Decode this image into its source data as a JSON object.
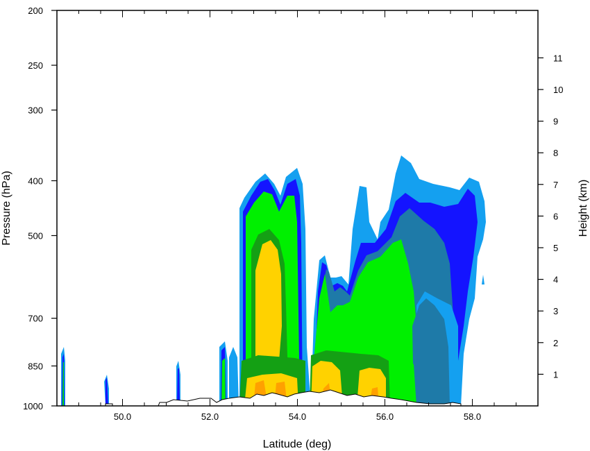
{
  "chart_data": {
    "type": "heatmap",
    "xlabel": "Latitude (deg)",
    "ylabel": "Pressure (hPa)",
    "y2label": "Height (km)",
    "xlim": [
      48.5,
      59.5
    ],
    "x_ticks": [
      50.0,
      52.0,
      54.0,
      56.0,
      58.0
    ],
    "x_tick_labels": [
      "50.0",
      "52.0",
      "54.0",
      "56.0",
      "58.0"
    ],
    "ylim": [
      1000,
      200
    ],
    "y_scale": "log",
    "y_ticks": [
      200,
      250,
      300,
      400,
      500,
      700,
      850,
      1000
    ],
    "y_tick_labels": [
      "200",
      "250",
      "300",
      "400",
      "500",
      "700",
      "850",
      "1000"
    ],
    "y2_ticks": [
      1,
      2,
      3,
      4,
      5,
      6,
      7,
      8,
      9,
      10,
      11
    ],
    "y2_tick_labels": [
      "1",
      "2",
      "3",
      "4",
      "5",
      "6",
      "7",
      "8",
      "9",
      "10",
      "11"
    ],
    "grid": false,
    "legend": "none",
    "colors": [
      "#14a0f0",
      "#1414ff",
      "#1e7aa8",
      "#00f000",
      "#14a014",
      "#ffd200",
      "#ffa000"
    ],
    "terrain_color": "#000000"
  }
}
